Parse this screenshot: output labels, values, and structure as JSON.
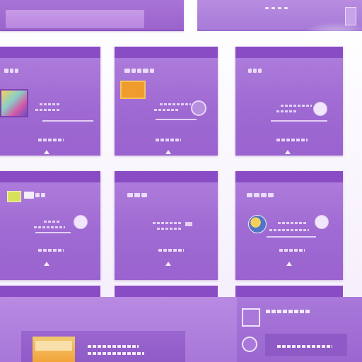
{
  "colors": {
    "accent": "#8a4cc4",
    "card": "#a26fd5",
    "light": "#efe2fb"
  },
  "icons": {
    "thumbnail": "image-thumbnail-icon",
    "avatar": "avatar-icon",
    "globe": "globe-icon",
    "expand": "caret-up-icon",
    "window": "window-icon"
  }
}
